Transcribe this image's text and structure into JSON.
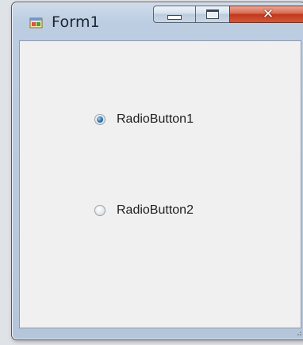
{
  "window": {
    "title": "Form1",
    "controls": {
      "minimize": "minimize",
      "maximize": "maximize",
      "close": "✕"
    }
  },
  "form": {
    "radio_buttons": [
      {
        "label": "RadioButton1",
        "checked": true
      },
      {
        "label": "RadioButton2",
        "checked": false
      }
    ]
  },
  "colors": {
    "title_bar": "#bccde2",
    "close_button": "#c2371a",
    "client_area": "#f0f0f0",
    "radio_checked": "#2d6fb0"
  }
}
